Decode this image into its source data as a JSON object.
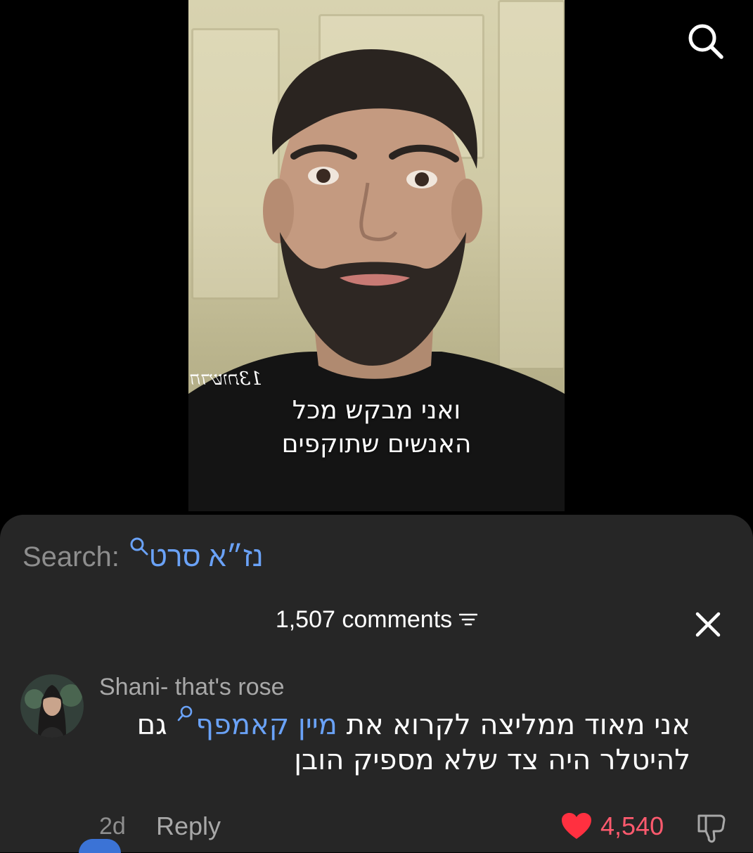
{
  "video": {
    "watermark": "חדשות13",
    "caption_lines": [
      "ואני מבקש מכל",
      "האנשים שתוקפים"
    ],
    "search_icon": "search-icon"
  },
  "search": {
    "label": "Search:",
    "query": "נז״א סרט",
    "icon": "search-icon"
  },
  "comments": {
    "header": "1,507 comments",
    "filter_icon": "filter-icon",
    "close_icon": "close-icon"
  },
  "comment": {
    "author": "Shani- that's rose",
    "body_line1_before": "אני מאוד ממליצה לקרוא את",
    "body_link": "מיין קאמפף",
    "body_line1_after": "גם",
    "body_line2": "להיטלר היה צד שלא מספיק הובן",
    "time": "2d",
    "reply_label": "Reply",
    "likes": "4,540",
    "like_color": "#ff3040",
    "link_color": "#6aa2f7"
  }
}
